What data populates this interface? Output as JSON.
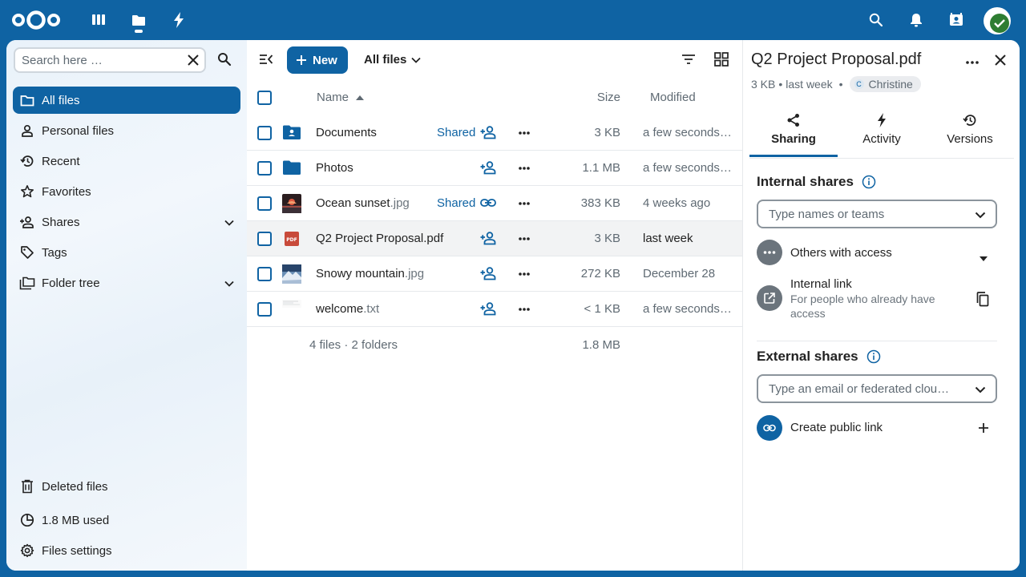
{
  "colors": {
    "primary": "#0f63a3",
    "text": "#222222",
    "muted": "#5f6a73"
  },
  "header": {
    "logo": "nextcloud-logo",
    "apps": [
      "dashboard-icon",
      "files-icon",
      "activity-icon"
    ],
    "right": [
      "search-icon",
      "notifications-icon",
      "contacts-icon",
      "user-avatar"
    ]
  },
  "nav": {
    "search_placeholder": "Search here …",
    "items": [
      {
        "label": "All files",
        "icon": "folder-icon",
        "active": true
      },
      {
        "label": "Personal files",
        "icon": "account-icon"
      },
      {
        "label": "Recent",
        "icon": "history-icon"
      },
      {
        "label": "Favorites",
        "icon": "star-icon"
      },
      {
        "label": "Shares",
        "icon": "share-icon",
        "expandable": true
      },
      {
        "label": "Tags",
        "icon": "tag-icon"
      },
      {
        "label": "Folder tree",
        "icon": "folder-tree-icon",
        "expandable": true
      }
    ],
    "footer": {
      "deleted": "Deleted files",
      "quota": "1.8 MB used",
      "settings": "Files settings"
    }
  },
  "toolbar": {
    "new_label": "New",
    "view_label": "All files"
  },
  "table": {
    "headers": {
      "name": "Name",
      "size": "Size",
      "modified": "Modified"
    },
    "rows": [
      {
        "name": "Documents",
        "ext": "",
        "type": "shared-folder",
        "shared": "Shared",
        "share_icon": "account-plus-icon",
        "size": "3 KB",
        "modified": "a few seconds ago"
      },
      {
        "name": "Photos",
        "ext": "",
        "type": "folder",
        "shared": "",
        "share_icon": "account-plus-icon",
        "size": "1.1 MB",
        "modified": "a few seconds ago"
      },
      {
        "name": "Ocean sunset",
        "ext": ".jpg",
        "type": "image-sunset",
        "shared": "Shared",
        "share_icon": "link-icon",
        "size": "383 KB",
        "modified": "4 weeks ago"
      },
      {
        "name": "Q2 Project Proposal.pdf",
        "ext": "",
        "type": "pdf",
        "shared": "",
        "share_icon": "account-plus-icon",
        "size": "3 KB",
        "modified": "last week",
        "selected": true
      },
      {
        "name": "Snowy mountain",
        "ext": ".jpg",
        "type": "image-mountain",
        "shared": "",
        "share_icon": "account-plus-icon",
        "size": "272 KB",
        "modified": "December 28"
      },
      {
        "name": "welcome",
        "ext": ".txt",
        "type": "text",
        "shared": "",
        "share_icon": "account-plus-icon",
        "size": "< 1 KB",
        "modified": "a few seconds ago"
      }
    ],
    "summary": {
      "counts": "4 files · 2 folders",
      "total": "1.8 MB"
    }
  },
  "sidebar": {
    "title": "Q2 Project Proposal.pdf",
    "size": "3 KB",
    "modified": "last week",
    "owner": "Christine",
    "owner_initial": "C",
    "tabs": [
      {
        "label": "Sharing",
        "icon": "share-variant-icon",
        "active": true
      },
      {
        "label": "Activity",
        "icon": "activity-icon"
      },
      {
        "label": "Versions",
        "icon": "history-icon"
      }
    ],
    "internal": {
      "title": "Internal shares",
      "placeholder": "Type names or teams",
      "others": "Others with access",
      "link_title": "Internal link",
      "link_sub": "For people who already have access"
    },
    "external": {
      "title": "External shares",
      "placeholder": "Type an email or federated clou…",
      "public_link": "Create public link"
    }
  }
}
